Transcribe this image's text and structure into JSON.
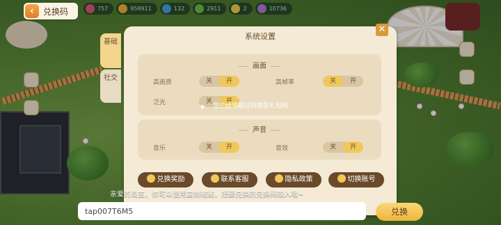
{
  "redeem_tag": {
    "label": "兑换码"
  },
  "resources": [
    {
      "value": "757",
      "icon": "heart-icon",
      "color": "#e05a7a"
    },
    {
      "value": "958911",
      "icon": "coin-icon",
      "color": "#f2b33a"
    },
    {
      "value": "132",
      "icon": "gem-icon",
      "color": "#4aa0e0"
    },
    {
      "value": "2911",
      "icon": "clover-icon",
      "color": "#6ac04a"
    },
    {
      "value": "2",
      "icon": "star-icon",
      "color": "#f0d050"
    },
    {
      "value": "10736",
      "icon": "ticket-icon",
      "color": "#b07ad8"
    }
  ],
  "dialog": {
    "title": "系统设置",
    "close": "✕",
    "tabs": [
      {
        "label": "基础"
      },
      {
        "label": "社交"
      }
    ],
    "graphics": {
      "title": "画面",
      "rows": [
        {
          "label": "高画质",
          "off": "关",
          "on": "开",
          "state": "on"
        },
        {
          "label": "高帧率",
          "off": "关",
          "on": "开",
          "state": "off"
        },
        {
          "label": "泛光",
          "off": "关",
          "on": "开",
          "state": "on"
        }
      ]
    },
    "sound": {
      "title": "声音",
      "rows": [
        {
          "label": "音乐",
          "off": "关",
          "on": "开",
          "state": "on"
        },
        {
          "label": "音效",
          "off": "关",
          "on": "开",
          "state": "on"
        }
      ]
    },
    "buttons": [
      {
        "label": "兑换奖励"
      },
      {
        "label": "联系客服"
      },
      {
        "label": "隐私政策"
      },
      {
        "label": "切换账号"
      }
    ]
  },
  "toast": {
    "text": "您已经领取过同类型礼包码"
  },
  "redeem": {
    "prompt": "亲爱的岛主，你可以使用复制粘贴，把要兑换的兑换码输入哦~",
    "input_value": "tap007T6M5",
    "button_label": "兑换"
  },
  "colors": {
    "accent": "#efb53a",
    "dialog_bg": "#f4ead6",
    "brown": "#6a4a2a"
  }
}
